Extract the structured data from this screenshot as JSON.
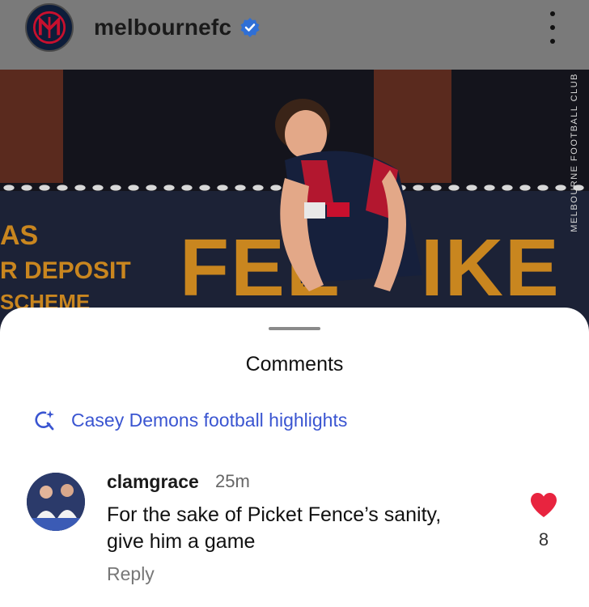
{
  "header": {
    "username": "melbournefc",
    "logo_icon": "melbourne-fc-logo-icon",
    "verified_icon": "verified-badge-icon",
    "more_icon": "more-vertical-icon"
  },
  "photo": {
    "vertical_label": "MELBOURNE FOOTBALL CLUB",
    "board_text_left_1": "AS",
    "board_text_left_2": "R DEPOSIT",
    "board_text_left_3": "SCHEME",
    "board_text_main_1": "FEE",
    "board_text_main_2": "IKE A"
  },
  "comments_sheet": {
    "title": "Comments",
    "search_suggestion": "Casey Demons football highlights",
    "search_icon": "search-sparkle-icon",
    "accent_color": "#3a55d1"
  },
  "comments": [
    {
      "username": "clamgrace",
      "time": "25m",
      "text_line_1": "For the sake of Picket Fence’s sanity,",
      "text_line_2": "give him a game",
      "reply_label": "Reply",
      "likes": "8",
      "liked": true,
      "like_color": "#e8243f"
    }
  ]
}
